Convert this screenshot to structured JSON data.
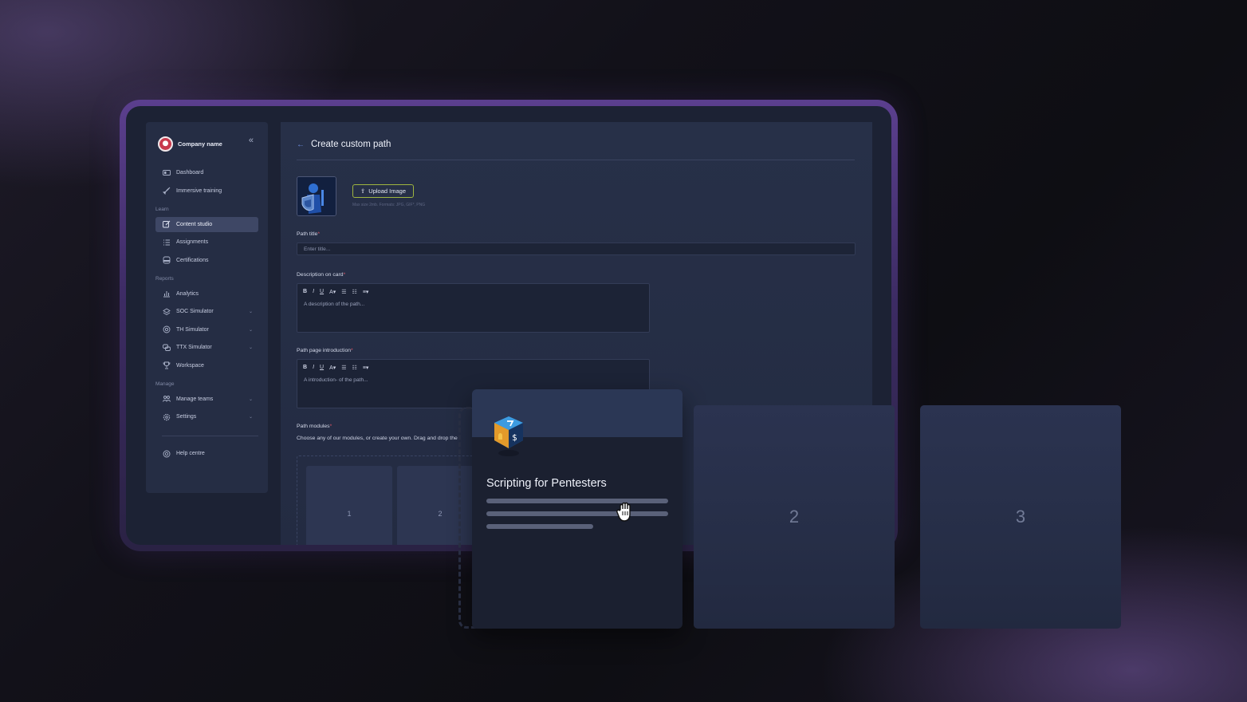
{
  "sidebar": {
    "company_name": "Company name",
    "items_top": [
      {
        "label": "Dashboard",
        "icon": "dashboard-icon"
      },
      {
        "label": "Immersive training",
        "icon": "rocket-icon"
      }
    ],
    "learn_label": "Learn",
    "items_learn": [
      {
        "label": "Content studio",
        "icon": "edit-icon",
        "active": true
      },
      {
        "label": "Assignments",
        "icon": "list-icon"
      },
      {
        "label": "Certifications",
        "icon": "certificate-icon"
      }
    ],
    "reports_label": "Reports",
    "items_reports": [
      {
        "label": "Analytics",
        "icon": "bar-chart-icon"
      },
      {
        "label": "SOC Simulator",
        "icon": "layers-icon",
        "expandable": true
      },
      {
        "label": "TH Simulator",
        "icon": "target-icon",
        "expandable": true
      },
      {
        "label": "TTX Simulator",
        "icon": "chat-icon",
        "expandable": true
      },
      {
        "label": "Workspace",
        "icon": "trophy-icon"
      }
    ],
    "manage_label": "Manage",
    "items_manage": [
      {
        "label": "Manage teams",
        "icon": "team-icon",
        "expandable": true
      },
      {
        "label": "Settings",
        "icon": "gear-icon",
        "expandable": true
      }
    ],
    "help": {
      "label": "Help centre",
      "icon": "lifebuoy-icon"
    }
  },
  "main": {
    "title": "Create custom path",
    "upload_label": "Upload Image",
    "upload_hint": "Max size 2mb. Formats: JPG, GIF*, PNG",
    "path_title_label": "Path title",
    "path_title_placeholder": "Enter title...",
    "description_label": "Description on card",
    "description_placeholder": "A description of the path...",
    "intro_label": "Path page introduction",
    "intro_placeholder": "A introduction- of the path...",
    "modules_label": "Path modules",
    "modules_hint": "Choose any of our modules, or create your own. Drag and drop the",
    "slots": [
      "1",
      "2"
    ],
    "toolbar": {
      "bold": "B",
      "italic": "I",
      "underline": "U",
      "font": "A▾",
      "bullets": "☰",
      "numbers": "☷",
      "align": "≡▾"
    }
  },
  "cards": {
    "module_title": "Scripting for Pentesters",
    "placeholders": [
      "2",
      "3"
    ]
  },
  "colors": {
    "accent": "#6f8fe0",
    "required": "#e05667",
    "upload_border": "#9fb53f",
    "frame": "#5b3f8e"
  }
}
